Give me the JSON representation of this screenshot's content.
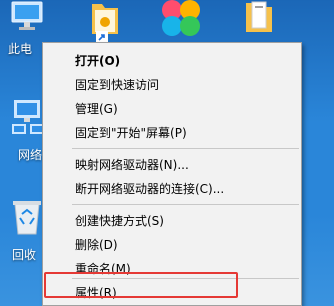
{
  "desktop": {
    "icons": [
      {
        "label": "此电"
      },
      {
        "label": "网络"
      },
      {
        "label": "回收"
      }
    ]
  },
  "context_menu": {
    "items": [
      {
        "label": "打开(O)",
        "bold": true
      },
      {
        "label": "固定到快速访问"
      },
      {
        "label": "管理(G)"
      },
      {
        "label": "固定到\"开始\"屏幕(P)"
      },
      {
        "label": "映射网络驱动器(N)..."
      },
      {
        "label": "断开网络驱动器的连接(C)..."
      },
      {
        "label": "创建快捷方式(S)"
      },
      {
        "label": "删除(D)"
      },
      {
        "label": "重命名(M)"
      },
      {
        "label": "属性(R)",
        "highlighted": true
      }
    ]
  },
  "colors": {
    "highlight_border": "#e53935",
    "desktop": "#2a86d9"
  }
}
